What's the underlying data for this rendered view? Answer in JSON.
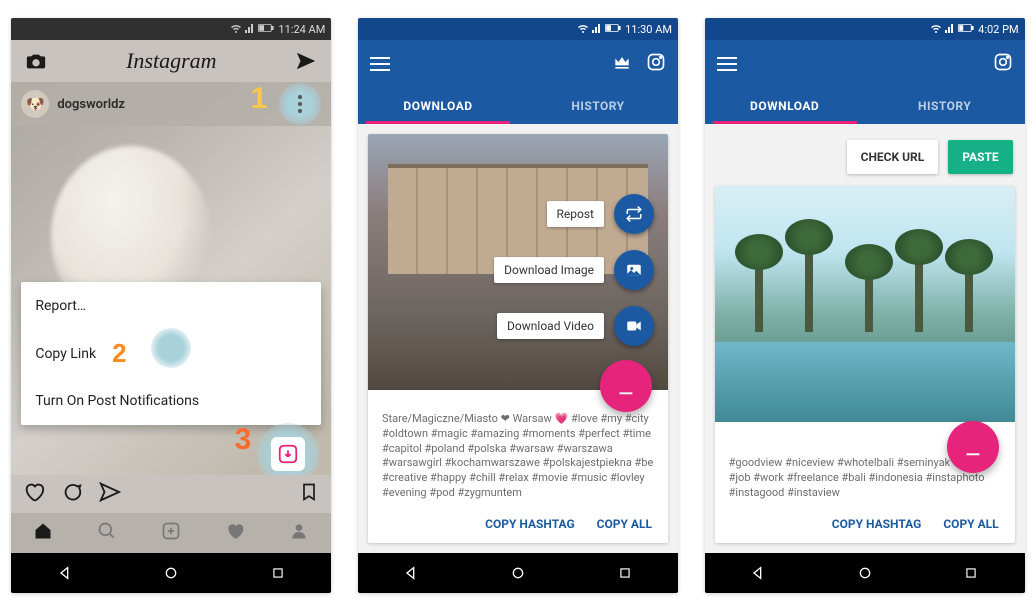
{
  "screen1": {
    "status_time": "11:24 AM",
    "app_title": "Instagram",
    "username": "dogsworldz",
    "annot1": "1",
    "annot2": "2",
    "annot3": "3",
    "menu": {
      "report": "Report…",
      "copy_link": "Copy Link",
      "notifications": "Turn On Post Notifications"
    }
  },
  "screen2": {
    "status_time": "11:30 AM",
    "tabs": {
      "download": "DOWNLOAD",
      "history": "HISTORY"
    },
    "fab": {
      "repost": "Repost",
      "download_image": "Download Image",
      "download_video": "Download Video"
    },
    "caption": "Stare/Magiczne/Miasto ❤ Warsaw 💗 #love #my #city #oldtown #magic #amazing #moments #perfect #time #capitol #poland #polska #warsaw #warszawa #warsawgirl #kochamwarszawe #polskajestpiekna #be #creative #happy #chill #relax #movie #music #lovley #evening #pod #zygmuntem",
    "actions": {
      "copy_hashtag": "COPY HASHTAG",
      "copy_all": "COPY ALL"
    }
  },
  "screen3": {
    "status_time": "4:02 PM",
    "tabs": {
      "download": "DOWNLOAD",
      "history": "HISTORY"
    },
    "buttons": {
      "check_url": "CHECK URL",
      "paste": "PASTE"
    },
    "caption": "#goodview #niceview #whotelbali #seminyak #event #job #work #freelance #bali #indonesia #instaphoto #instagood #instaview",
    "actions": {
      "copy_hashtag": "COPY HASHTAG",
      "copy_all": "COPY ALL"
    }
  }
}
